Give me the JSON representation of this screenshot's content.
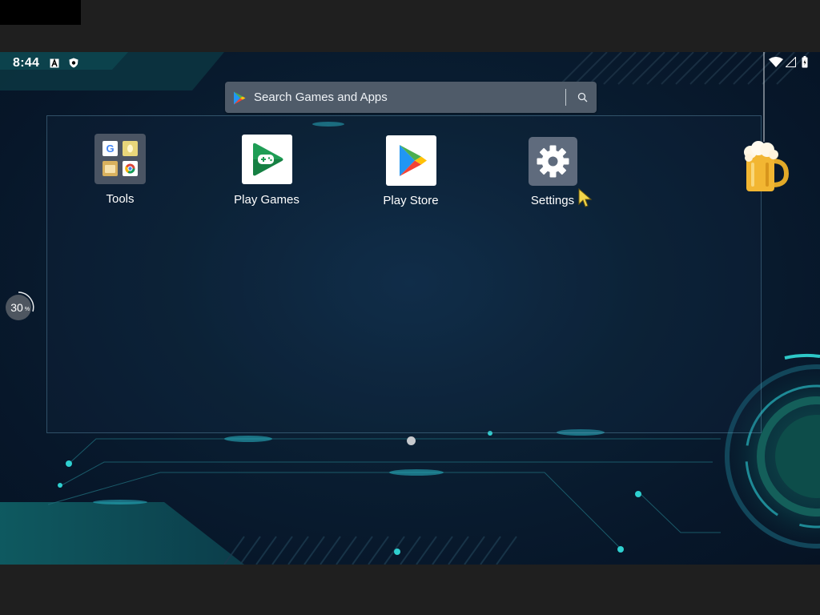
{
  "status_bar": {
    "time": "8:44",
    "left_icons": [
      "font-a-icon",
      "shield-icon"
    ],
    "right_icons": [
      "wifi-icon",
      "signal-icon",
      "battery-icon"
    ]
  },
  "search": {
    "placeholder": "Search Games and Apps",
    "icon": "play-store-icon",
    "action_icon": "search-icon"
  },
  "apps": [
    {
      "label": "Tools",
      "icon": "tools-folder-icon"
    },
    {
      "label": "Play Games",
      "icon": "play-games-icon"
    },
    {
      "label": "Play Store",
      "icon": "play-store-icon"
    },
    {
      "label": "Settings",
      "icon": "gear-icon"
    }
  ],
  "floating": {
    "progress_value": "30",
    "progress_unit": "%",
    "progress_fraction": 0.3
  },
  "pager": {
    "pages": 1,
    "current": 1
  },
  "colors": {
    "accent": "#2ec8c8",
    "search_bg": "#4f5b69",
    "settings_tile": "#5f6b7d"
  }
}
